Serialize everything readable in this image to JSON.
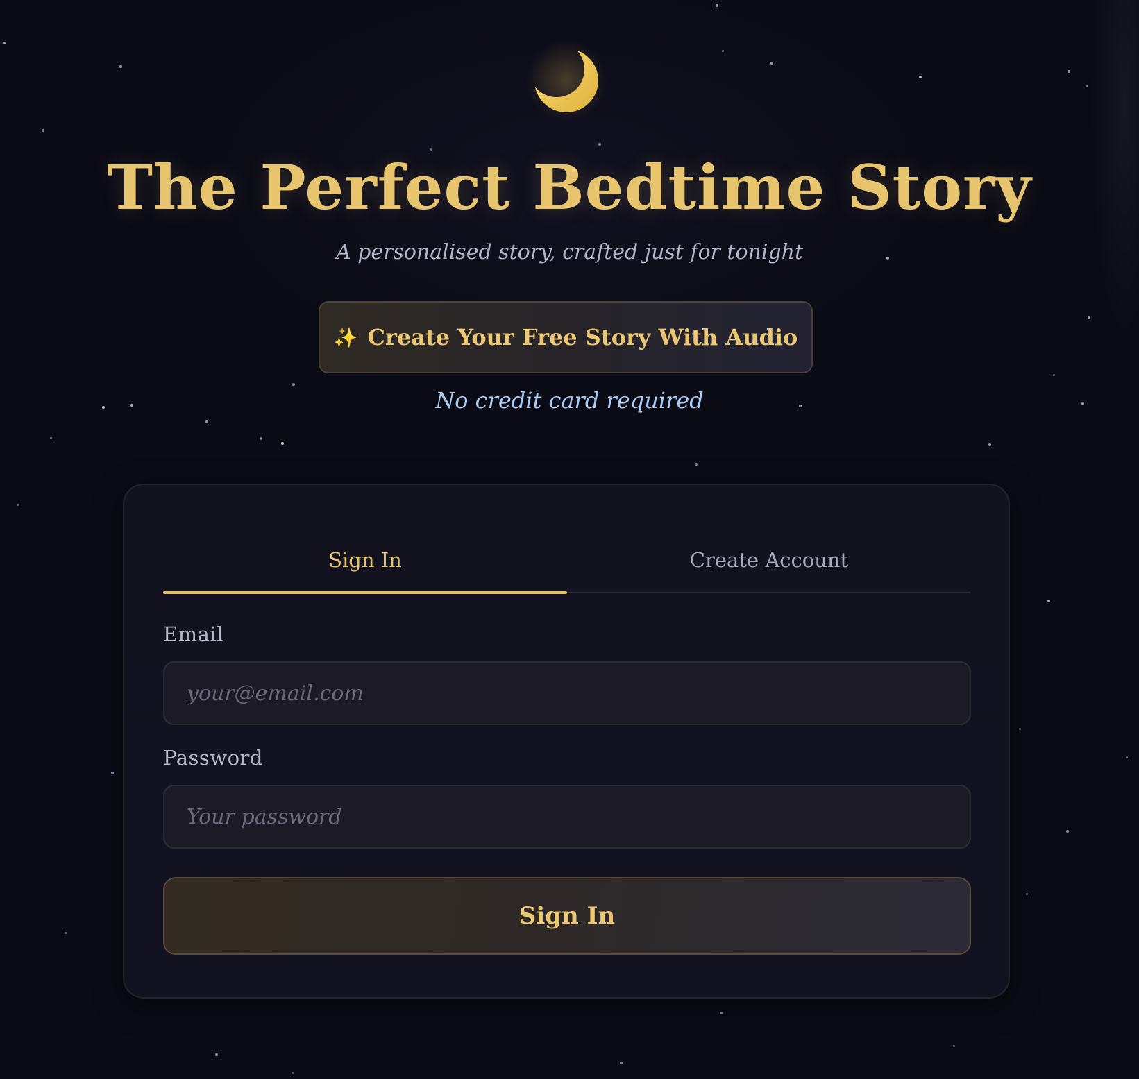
{
  "header": {
    "title": "The Perfect Bedtime Story",
    "subtitle": "A personalised story, crafted just for tonight"
  },
  "cta": {
    "icon": "sparkles-icon",
    "sparkle": "✨",
    "label": "Create Your Free Story With Audio",
    "note": "No credit card required"
  },
  "auth": {
    "tabs": [
      {
        "label": "Sign In",
        "active": true
      },
      {
        "label": "Create Account",
        "active": false
      }
    ],
    "email": {
      "label": "Email",
      "placeholder": "your@email.com",
      "value": ""
    },
    "password": {
      "label": "Password",
      "placeholder": "Your password",
      "value": ""
    },
    "submit_label": "Sign In"
  },
  "colors": {
    "background": "#0b0b16",
    "accent_gold": "#e7c46e",
    "note_blue": "#a9cdf2",
    "card": "#131320"
  },
  "icons": {
    "moon": "crescent-moon-icon"
  }
}
